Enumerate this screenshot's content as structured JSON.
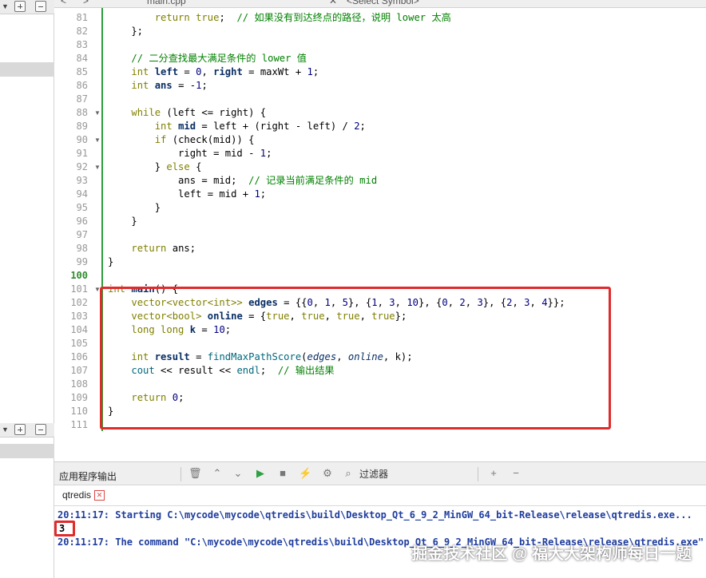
{
  "editor_header": {
    "file_name": "main.cpp",
    "symbol_placeholder": "<Select Symbol>"
  },
  "code_lines": [
    {
      "n": "81",
      "segments": [
        [
          "",
          "        "
        ],
        [
          "kw",
          "return"
        ],
        [
          "",
          " "
        ],
        [
          "kw",
          "true"
        ],
        [
          "",
          ";  "
        ],
        [
          "cm",
          "// 如果没有到达终点的路径，说明 lower 太高"
        ]
      ]
    },
    {
      "n": "82",
      "segments": [
        [
          "",
          "    };"
        ]
      ]
    },
    {
      "n": "83",
      "segments": [
        [
          "",
          ""
        ]
      ]
    },
    {
      "n": "84",
      "segments": [
        [
          "",
          "    "
        ],
        [
          "cm",
          "// 二分查找最大满足条件的 lower 值"
        ]
      ]
    },
    {
      "n": "85",
      "segments": [
        [
          "",
          "    "
        ],
        [
          "ty",
          "int"
        ],
        [
          "",
          " "
        ],
        [
          "id",
          "left"
        ],
        [
          "",
          " = "
        ],
        [
          "num",
          "0"
        ],
        [
          "",
          ", "
        ],
        [
          "id",
          "right"
        ],
        [
          "",
          " = maxWt + "
        ],
        [
          "num",
          "1"
        ],
        [
          "",
          ";"
        ]
      ]
    },
    {
      "n": "86",
      "segments": [
        [
          "",
          "    "
        ],
        [
          "ty",
          "int"
        ],
        [
          "",
          " "
        ],
        [
          "id",
          "ans"
        ],
        [
          "",
          " = -"
        ],
        [
          "num",
          "1"
        ],
        [
          "",
          ";"
        ]
      ]
    },
    {
      "n": "87",
      "segments": [
        [
          "",
          ""
        ]
      ]
    },
    {
      "n": "88",
      "segments": [
        [
          "",
          "    "
        ],
        [
          "kw",
          "while"
        ],
        [
          "",
          " (left <= right) {"
        ]
      ]
    },
    {
      "n": "89",
      "segments": [
        [
          "",
          "        "
        ],
        [
          "ty",
          "int"
        ],
        [
          "",
          " "
        ],
        [
          "id",
          "mid"
        ],
        [
          "",
          " = left + (right - left) / "
        ],
        [
          "num",
          "2"
        ],
        [
          "",
          ";"
        ]
      ]
    },
    {
      "n": "90",
      "segments": [
        [
          "",
          "        "
        ],
        [
          "kw",
          "if"
        ],
        [
          "",
          " (check(mid)) {"
        ]
      ]
    },
    {
      "n": "91",
      "segments": [
        [
          "",
          "            right = mid - "
        ],
        [
          "num",
          "1"
        ],
        [
          "",
          ";"
        ]
      ]
    },
    {
      "n": "92",
      "segments": [
        [
          "",
          "        } "
        ],
        [
          "kw",
          "else"
        ],
        [
          "",
          " {"
        ]
      ]
    },
    {
      "n": "93",
      "segments": [
        [
          "",
          "            ans = mid;  "
        ],
        [
          "cm",
          "// 记录当前满足条件的 mid"
        ]
      ]
    },
    {
      "n": "94",
      "segments": [
        [
          "",
          "            left = mid + "
        ],
        [
          "num",
          "1"
        ],
        [
          "",
          ";"
        ]
      ]
    },
    {
      "n": "95",
      "segments": [
        [
          "",
          "        }"
        ]
      ]
    },
    {
      "n": "96",
      "segments": [
        [
          "",
          "    }"
        ]
      ]
    },
    {
      "n": "97",
      "segments": [
        [
          "",
          ""
        ]
      ]
    },
    {
      "n": "98",
      "segments": [
        [
          "",
          "    "
        ],
        [
          "kw",
          "return"
        ],
        [
          "",
          " ans;"
        ]
      ]
    },
    {
      "n": "99",
      "segments": [
        [
          "",
          "}"
        ]
      ]
    },
    {
      "n": "100",
      "segments": [
        [
          "",
          ""
        ]
      ]
    },
    {
      "n": "101",
      "segments": [
        [
          "ty",
          "int"
        ],
        [
          "",
          " "
        ],
        [
          "id",
          "main"
        ],
        [
          "",
          "() {"
        ]
      ]
    },
    {
      "n": "102",
      "segments": [
        [
          "",
          "    "
        ],
        [
          "ty",
          "vector<vector<int>>"
        ],
        [
          "",
          " "
        ],
        [
          "id",
          "edges"
        ],
        [
          "",
          " = {{"
        ],
        [
          "num",
          "0"
        ],
        [
          "",
          ", "
        ],
        [
          "num",
          "1"
        ],
        [
          "",
          ", "
        ],
        [
          "num",
          "5"
        ],
        [
          "",
          "}, {"
        ],
        [
          "num",
          "1"
        ],
        [
          "",
          ", "
        ],
        [
          "num",
          "3"
        ],
        [
          "",
          ", "
        ],
        [
          "num",
          "10"
        ],
        [
          "",
          "}, {"
        ],
        [
          "num",
          "0"
        ],
        [
          "",
          ", "
        ],
        [
          "num",
          "2"
        ],
        [
          "",
          ", "
        ],
        [
          "num",
          "3"
        ],
        [
          "",
          "}, {"
        ],
        [
          "num",
          "2"
        ],
        [
          "",
          ", "
        ],
        [
          "num",
          "3"
        ],
        [
          "",
          ", "
        ],
        [
          "num",
          "4"
        ],
        [
          "",
          "}};"
        ]
      ]
    },
    {
      "n": "103",
      "segments": [
        [
          "",
          "    "
        ],
        [
          "ty",
          "vector<bool>"
        ],
        [
          "",
          " "
        ],
        [
          "id",
          "online"
        ],
        [
          "",
          " = {"
        ],
        [
          "kw",
          "true"
        ],
        [
          "",
          ", "
        ],
        [
          "kw",
          "true"
        ],
        [
          "",
          ", "
        ],
        [
          "kw",
          "true"
        ],
        [
          "",
          ", "
        ],
        [
          "kw",
          "true"
        ],
        [
          "",
          "};"
        ]
      ]
    },
    {
      "n": "104",
      "segments": [
        [
          "",
          "    "
        ],
        [
          "ty",
          "long long"
        ],
        [
          "",
          " "
        ],
        [
          "id",
          "k"
        ],
        [
          "",
          " = "
        ],
        [
          "num",
          "10"
        ],
        [
          "",
          ";"
        ]
      ]
    },
    {
      "n": "105",
      "segments": [
        [
          "",
          ""
        ]
      ]
    },
    {
      "n": "106",
      "segments": [
        [
          "",
          "    "
        ],
        [
          "ty",
          "int"
        ],
        [
          "",
          " "
        ],
        [
          "id",
          "result"
        ],
        [
          "",
          " = "
        ],
        [
          "fn",
          "findMaxPathScore"
        ],
        [
          "",
          "("
        ],
        [
          "it",
          "edges"
        ],
        [
          "",
          ", "
        ],
        [
          "it",
          "online"
        ],
        [
          "",
          ", k);"
        ]
      ]
    },
    {
      "n": "107",
      "segments": [
        [
          "",
          "    "
        ],
        [
          "fn",
          "cout"
        ],
        [
          "",
          " << result << "
        ],
        [
          "fn",
          "endl"
        ],
        [
          "",
          ";  "
        ],
        [
          "cm",
          "// 输出结果"
        ]
      ]
    },
    {
      "n": "108",
      "segments": [
        [
          "",
          ""
        ]
      ]
    },
    {
      "n": "109",
      "segments": [
        [
          "",
          "    "
        ],
        [
          "kw",
          "return"
        ],
        [
          "",
          " "
        ],
        [
          "num",
          "0"
        ],
        [
          "",
          ";"
        ]
      ]
    },
    {
      "n": "110",
      "segments": [
        [
          "",
          "}"
        ]
      ]
    },
    {
      "n": "111",
      "segments": [
        [
          "",
          ""
        ]
      ]
    }
  ],
  "fold_markers": [
    "88",
    "90",
    "92",
    "101"
  ],
  "current_line": "100",
  "output": {
    "title": "应用程序输出",
    "filter_label": "过滤器",
    "tab_label": "qtredis",
    "lines": [
      "20:11:17: Starting C:\\mycode\\mycode\\qtredis\\build\\Desktop_Qt_6_9_2_MinGW_64_bit-Release\\release\\qtredis.exe...",
      "3",
      "20:11:17: The command \"C:\\mycode\\mycode\\qtredis\\build\\Desktop_Qt_6_9_2_MinGW_64_bit-Release\\release\\qtredis.exe\""
    ]
  },
  "watermark": "掘金技术社区 @ 福大大架构师每日一题",
  "colors": {
    "highlight_box": "#e02b2b",
    "change_bar": "#2e9c3a",
    "output_blue": "#1f3d9e"
  }
}
